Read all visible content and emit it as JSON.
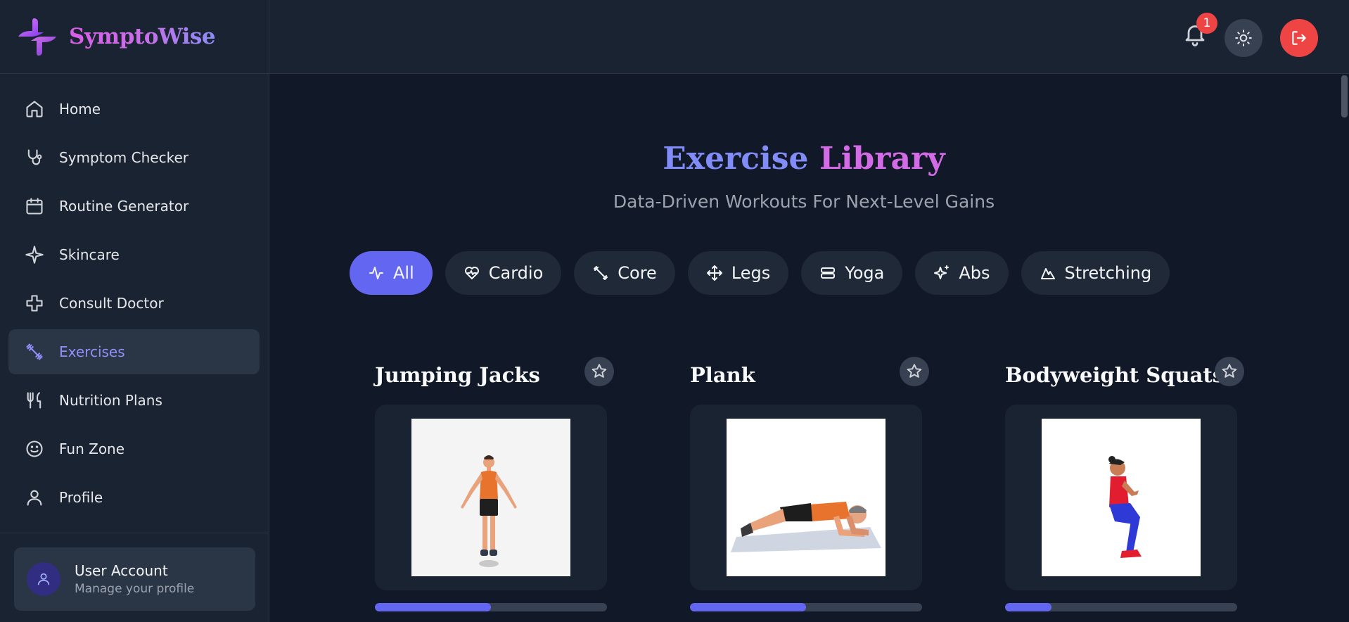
{
  "brand": {
    "name": "SymptoWise"
  },
  "sidebar": {
    "items": [
      {
        "label": "Home",
        "icon": "home-icon",
        "active": false
      },
      {
        "label": "Symptom Checker",
        "icon": "stethoscope-icon",
        "active": false
      },
      {
        "label": "Routine Generator",
        "icon": "calendar-icon",
        "active": false
      },
      {
        "label": "Skincare",
        "icon": "sparkle-icon",
        "active": false
      },
      {
        "label": "Consult Doctor",
        "icon": "medical-cross-icon",
        "active": false
      },
      {
        "label": "Exercises",
        "icon": "dumbbell-icon",
        "active": true
      },
      {
        "label": "Nutrition Plans",
        "icon": "utensils-icon",
        "active": false
      },
      {
        "label": "Fun Zone",
        "icon": "smile-icon",
        "active": false
      },
      {
        "label": "Profile",
        "icon": "user-icon",
        "active": false
      }
    ],
    "user": {
      "title": "User Account",
      "subtitle": "Manage your profile"
    }
  },
  "header": {
    "notification_count": "1",
    "icons": [
      "bell-icon",
      "sun-icon",
      "logout-icon"
    ]
  },
  "main": {
    "title_part1": "Exercise",
    "title_part2": "Library",
    "subtitle": "Data-Driven Workouts For Next-Level Gains",
    "filters": [
      {
        "label": "All",
        "icon": "activity-icon",
        "active": true
      },
      {
        "label": "Cardio",
        "icon": "heart-pulse-icon",
        "active": false
      },
      {
        "label": "Core",
        "icon": "dumbbell-icon",
        "active": false
      },
      {
        "label": "Legs",
        "icon": "move-icon",
        "active": false
      },
      {
        "label": "Yoga",
        "icon": "mat-icon",
        "active": false
      },
      {
        "label": "Abs",
        "icon": "sparkles-icon",
        "active": false
      },
      {
        "label": "Stretching",
        "icon": "mountain-icon",
        "active": false
      }
    ],
    "exercises": [
      {
        "name": "Jumping Jacks",
        "progress": 0.5
      },
      {
        "name": "Plank",
        "progress": 0.5
      },
      {
        "name": "Bodyweight Squats",
        "progress": 0.2
      }
    ]
  },
  "colors": {
    "accent": "#6366f1",
    "accent_text": "#8f8ff8",
    "brand_pink": "#d36be6",
    "danger": "#ef4444",
    "background": "#111827",
    "panel": "#1a2332"
  }
}
